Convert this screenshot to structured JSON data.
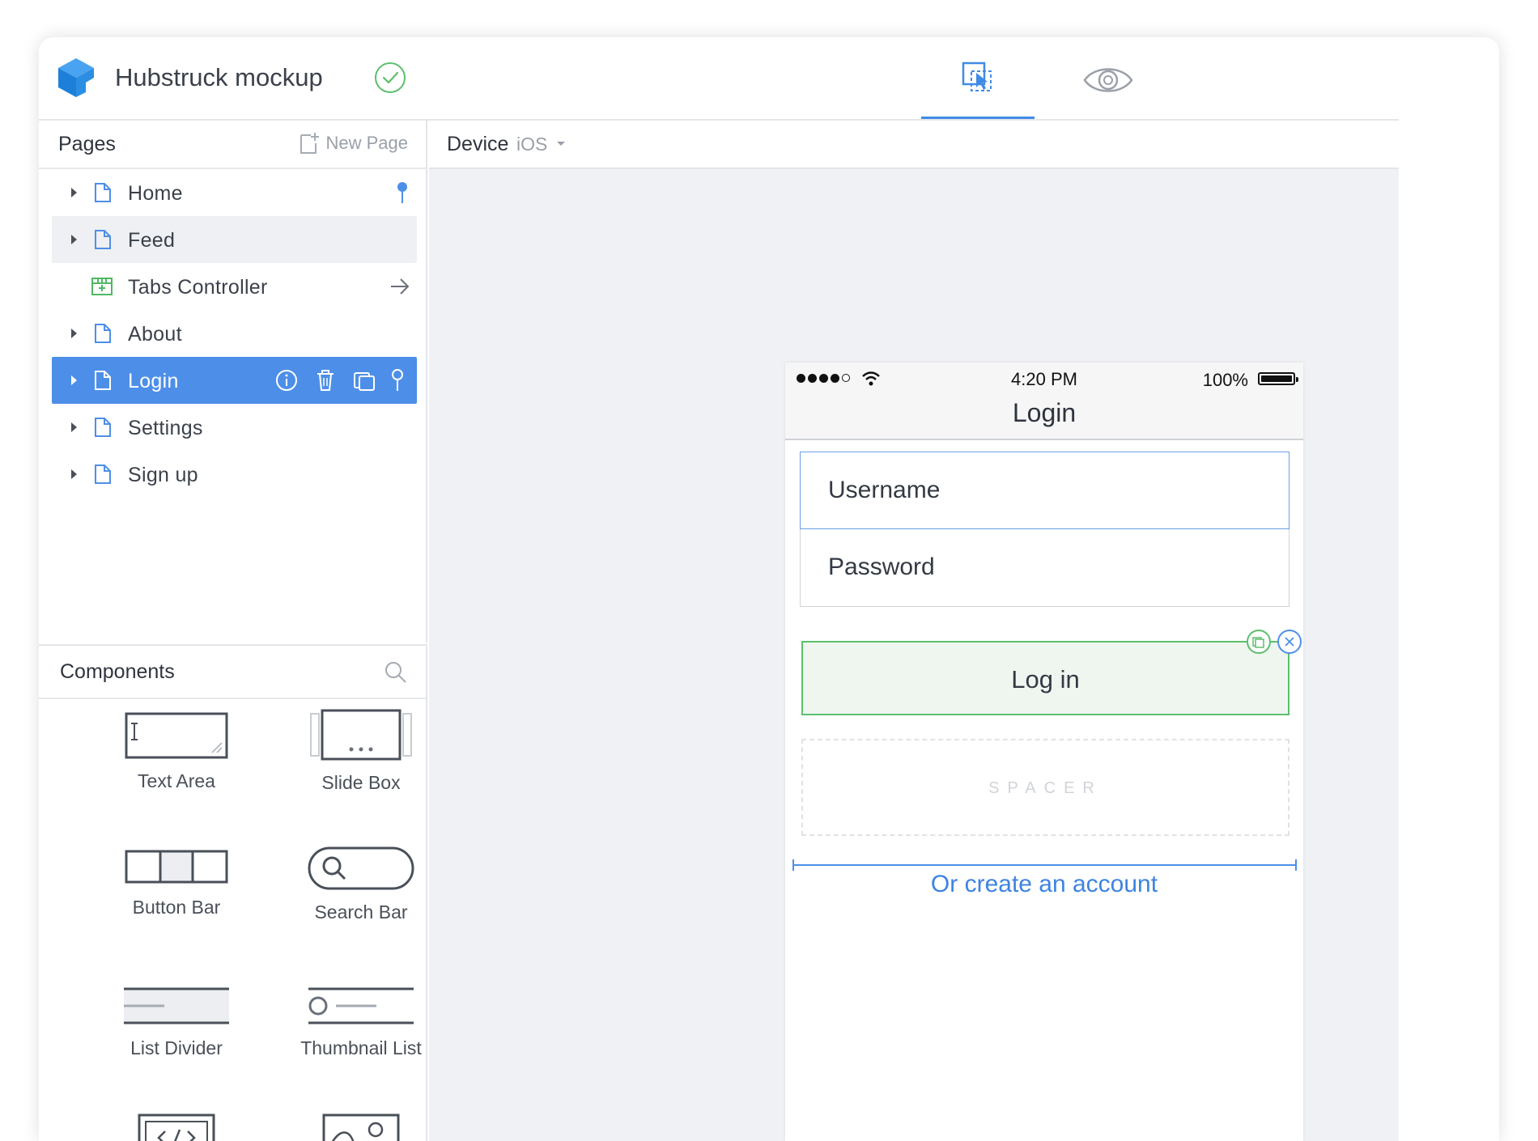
{
  "app": {
    "title": "Hubstruck mockup"
  },
  "header": {
    "modes": [
      "edit-mode",
      "preview-mode"
    ],
    "active_mode": "edit-mode"
  },
  "pages": {
    "title": "Pages",
    "new_page_label": "New Page",
    "items": [
      {
        "label": "Home",
        "pinned": true
      },
      {
        "label": "Feed",
        "state": "hover"
      },
      {
        "label": "Tabs Controller",
        "type": "tabs-controller"
      },
      {
        "label": "About"
      },
      {
        "label": "Login",
        "state": "selected"
      },
      {
        "label": "Settings"
      },
      {
        "label": "Sign up"
      }
    ]
  },
  "device": {
    "label": "Device",
    "value": "iOS"
  },
  "components": {
    "title": "Components",
    "items": [
      {
        "label": "Text Area"
      },
      {
        "label": "Slide Box"
      },
      {
        "label": "Button Bar"
      },
      {
        "label": "Search Bar"
      },
      {
        "label": "List Divider"
      },
      {
        "label": "Thumbnail List"
      }
    ]
  },
  "phone": {
    "status": {
      "time": "4:20 PM",
      "battery": "100%"
    },
    "nav_title": "Login",
    "username_placeholder": "Username",
    "password_placeholder": "Password",
    "login_button": "Log in",
    "spacer_label": "SPACER",
    "create_account_link": "Or create an account"
  },
  "colors": {
    "accent": "#4d8fe8",
    "success": "#5bbf6c",
    "canvas": "#eff1f4"
  }
}
